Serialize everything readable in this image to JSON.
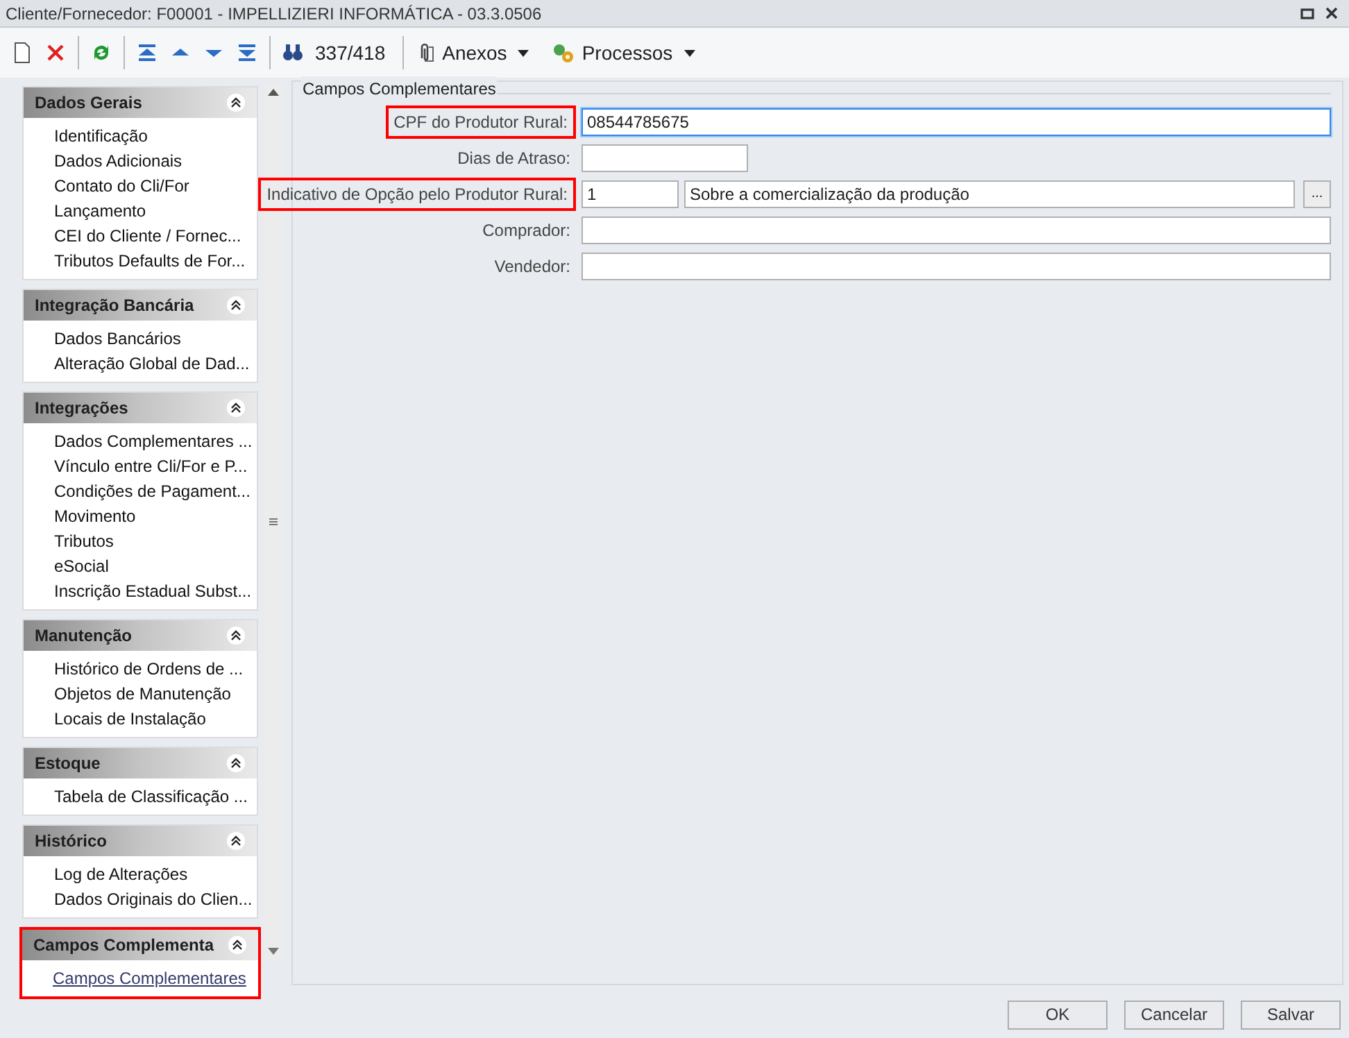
{
  "window": {
    "title": "Cliente/Fornecedor: F00001 - IMPELLIZIERI INFORMÁTICA - 03.3.0506"
  },
  "toolbar": {
    "counter": "337/418",
    "menus": [
      {
        "kind": "attachments",
        "label": "Anexos"
      },
      {
        "kind": "processes",
        "label": "Processos"
      }
    ]
  },
  "sidebar": {
    "sections": [
      {
        "title": "Dados Gerais",
        "highlighted": false,
        "items": [
          {
            "label": "Identificação",
            "selected": false
          },
          {
            "label": "Dados Adicionais",
            "selected": false
          },
          {
            "label": "Contato do Cli/For",
            "selected": false
          },
          {
            "label": "Lançamento",
            "selected": false
          },
          {
            "label": "CEI do Cliente / Fornec...",
            "selected": false
          },
          {
            "label": "Tributos Defaults de For...",
            "selected": false
          }
        ]
      },
      {
        "title": "Integração Bancária",
        "highlighted": false,
        "items": [
          {
            "label": "Dados Bancários",
            "selected": false
          },
          {
            "label": "Alteração Global de Dad...",
            "selected": false
          }
        ]
      },
      {
        "title": "Integrações",
        "highlighted": false,
        "items": [
          {
            "label": "Dados Complementares ...",
            "selected": false
          },
          {
            "label": "Vínculo entre Cli/For e P...",
            "selected": false
          },
          {
            "label": "Condições de Pagament...",
            "selected": false
          },
          {
            "label": "Movimento",
            "selected": false
          },
          {
            "label": "Tributos",
            "selected": false
          },
          {
            "label": "eSocial",
            "selected": false
          },
          {
            "label": "Inscrição Estadual Subst...",
            "selected": false
          }
        ]
      },
      {
        "title": "Manutenção",
        "highlighted": false,
        "items": [
          {
            "label": "Histórico de Ordens de ...",
            "selected": false
          },
          {
            "label": "Objetos de Manutenção",
            "selected": false
          },
          {
            "label": "Locais de Instalação",
            "selected": false
          }
        ]
      },
      {
        "title": "Estoque",
        "highlighted": false,
        "items": [
          {
            "label": "Tabela de Classificação ...",
            "selected": false
          }
        ]
      },
      {
        "title": "Histórico",
        "highlighted": false,
        "items": [
          {
            "label": "Log de Alterações",
            "selected": false
          },
          {
            "label": "Dados Originais do Clien...",
            "selected": false
          }
        ]
      },
      {
        "title": "Campos Complementa",
        "highlighted": true,
        "items": [
          {
            "label": "Campos Complementares",
            "selected": true
          }
        ]
      }
    ]
  },
  "form": {
    "group_title": "Campos Complementares",
    "fields": [
      {
        "kind": "text",
        "label": "CPF do Produtor Rural:",
        "value": "08544785675",
        "highlighted": true,
        "focused": true
      },
      {
        "kind": "short_text",
        "label": "Dias de Atraso:",
        "highlighted": false,
        "focused": false
      },
      {
        "kind": "lookup",
        "label": "Indicativo de Opção pelo Produtor Rural:",
        "value": "1",
        "description": "Sobre a comercialização da produção",
        "button": "...",
        "highlighted": true,
        "focused": false
      },
      {
        "kind": "text",
        "label": "Comprador:",
        "highlighted": false,
        "focused": false
      },
      {
        "kind": "text",
        "label": "Vendedor:",
        "highlighted": false,
        "focused": false
      }
    ]
  },
  "buttons": [
    "OK",
    "Cancelar",
    "Salvar"
  ]
}
